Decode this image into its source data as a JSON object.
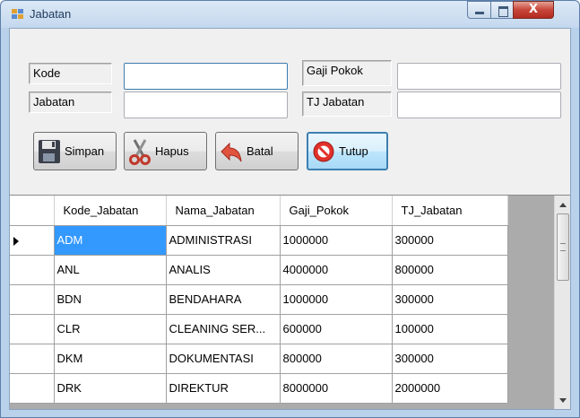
{
  "window": {
    "title": "Jabatan",
    "close_glyph": "X"
  },
  "form": {
    "kode_label": "Kode",
    "kode_value": "",
    "jabatan_label": "Jabatan",
    "jabatan_value": "",
    "gaji_pokok_label": "Gaji Pokok",
    "gaji_pokok_value": "",
    "tj_jabatan_label": "TJ Jabatan",
    "tj_jabatan_value": ""
  },
  "buttons": {
    "simpan": "Simpan",
    "hapus": "Hapus",
    "batal": "Batal",
    "tutup": "Tutup"
  },
  "grid": {
    "columns": [
      "Kode_Jabatan",
      "Nama_Jabatan",
      "Gaji_Pokok",
      "TJ_Jabatan"
    ],
    "rows": [
      [
        "ADM",
        "ADMINISTRASI",
        "1000000",
        "300000"
      ],
      [
        "ANL",
        "ANALIS",
        "4000000",
        "800000"
      ],
      [
        "BDN",
        "BENDAHARA",
        "1000000",
        "300000"
      ],
      [
        "CLR",
        "CLEANING SER...",
        "600000",
        "100000"
      ],
      [
        "DKM",
        "DOKUMENTASI",
        "800000",
        "300000"
      ],
      [
        "DRK",
        "DIREKTUR",
        "8000000",
        "2000000"
      ]
    ],
    "selected_row": 0
  },
  "colors": {
    "selection": "#3399ff",
    "window_frame": "#b9d1ea",
    "close_button": "#c8453a"
  },
  "icons": {
    "app": "form-icon",
    "simpan": "floppy-disk-icon",
    "hapus": "scissors-icon",
    "batal": "undo-arrow-icon",
    "tutup": "stop-sign-icon"
  }
}
